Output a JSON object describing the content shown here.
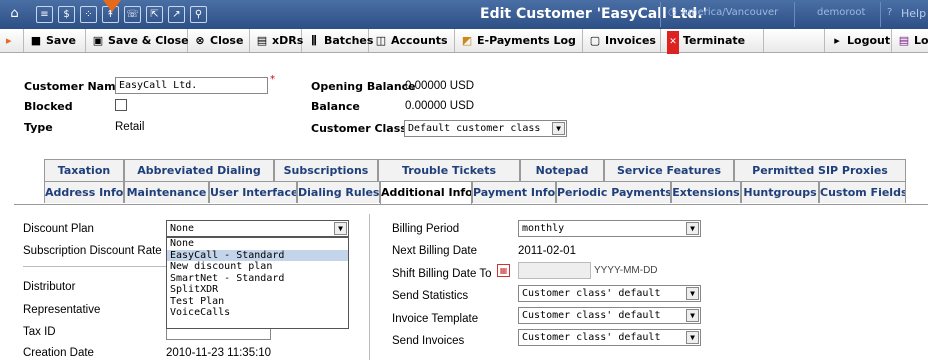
{
  "title": "Edit Customer 'EasyCall Ltd.'",
  "timezone": "America/Vancouver",
  "user": "demoroot",
  "help": "Help",
  "toolbar": {
    "save": "Save",
    "save_close": "Save & Close",
    "close": "Close",
    "xdrs": "xDRs",
    "batches": "Batches",
    "accounts": "Accounts",
    "epayments": "E-Payments Log",
    "invoices": "Invoices",
    "terminate": "Terminate",
    "logout": "Logout",
    "log": "Log"
  },
  "customer": {
    "name_label": "Customer Name",
    "name_value": "EasyCall Ltd.",
    "required": "*",
    "blocked_label": "Blocked",
    "type_label": "Type",
    "type_value": "Retail",
    "opening_balance_label": "Opening Balance",
    "opening_balance_value": "0.00000 USD",
    "balance_label": "Balance",
    "balance_value": "0.00000 USD",
    "class_label": "Customer Class",
    "class_value": "Default customer class"
  },
  "tabs_row1": [
    "Taxation",
    "Abbreviated Dialing",
    "Subscriptions",
    "Trouble Tickets",
    "Notepad",
    "Service Features",
    "Permitted SIP Proxies"
  ],
  "tabs_row2": [
    "Address Info",
    "Maintenance",
    "User Interface",
    "Dialing Rules",
    "Additional Info",
    "Payment Info",
    "Periodic Payments",
    "Extensions",
    "Huntgroups",
    "Custom Fields"
  ],
  "left": {
    "discount_plan_label": "Discount Plan",
    "discount_plan_value": "None",
    "subscription_discount_label": "Subscription Discount Rate",
    "distributor_label": "Distributor",
    "representative_label": "Representative",
    "tax_id_label": "Tax ID",
    "creation_date_label": "Creation Date",
    "creation_date_value": "2010-11-23 11:35:10",
    "dropdown_options": [
      "None",
      "EasyCall - Standard",
      "New discount plan",
      "SmartNet - Standard",
      "SplitXDR",
      "Test Plan",
      "VoiceCalls"
    ]
  },
  "right": {
    "billing_period_label": "Billing Period",
    "billing_period_value": "monthly",
    "next_billing_label": "Next Billing Date",
    "next_billing_value": "2011-02-01",
    "shift_billing_label": "Shift Billing Date To",
    "date_format": "YYYY-MM-DD",
    "send_statistics_label": "Send Statistics",
    "send_statistics_value": "Customer class' default",
    "invoice_template_label": "Invoice Template",
    "invoice_template_value": "Customer class' default",
    "send_invoices_label": "Send Invoices",
    "send_invoices_value": "Customer class' default"
  }
}
